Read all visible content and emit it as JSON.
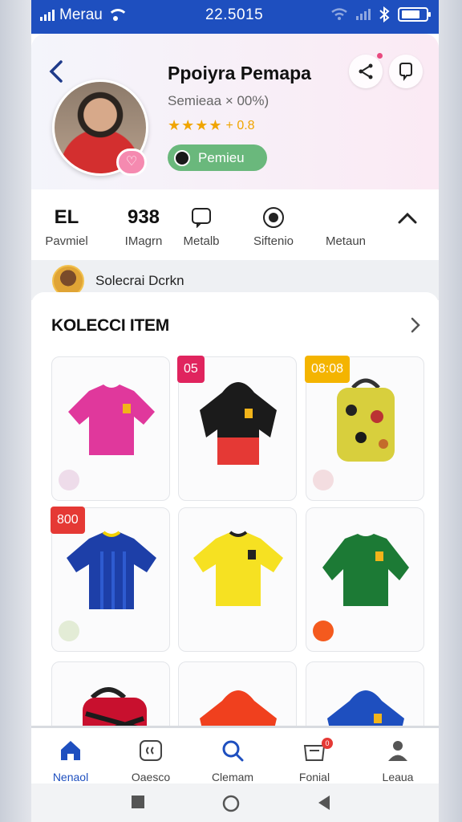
{
  "status_bar": {
    "carrier": "Merau",
    "time": "22.5015"
  },
  "profile": {
    "name": "Ppoiyra Pemapa",
    "subtitle": "Semieaa × 00%)",
    "rating_stars": "★★★★",
    "rating_text": "+ 0.8",
    "premium_label": "Pemieu"
  },
  "stats": [
    {
      "value": "EL",
      "label": "Pavmiel"
    },
    {
      "value": "938",
      "label": "IMagrn"
    },
    {
      "icon": "square-chat-icon",
      "label": "Metalb"
    },
    {
      "icon": "record-icon",
      "label": "Siftenio"
    },
    {
      "icon": "",
      "label": "Metaun"
    }
  ],
  "selection": {
    "text": "Solecrai Dcrkn"
  },
  "collection": {
    "title": "KOLECCI ITEM",
    "items": [
      {
        "name": "magenta-jersey",
        "tag": "",
        "color": "#e0389c",
        "dot": "#eedcea"
      },
      {
        "name": "black-red-hoodie",
        "tag": "05",
        "tag_color": "#e0245e",
        "color": "#1b1b1b",
        "accent": "#e53935"
      },
      {
        "name": "yellow-patch-backpack",
        "tag": "08:08",
        "tag_color": "#f4b400",
        "color": "#d8cf3d",
        "dot": "#f3dde0"
      },
      {
        "name": "blue-striped-jersey",
        "tag": "800",
        "tag_color": "#e53935",
        "color": "#1d3fa8",
        "accent": "#f2d200",
        "dot": "#e3ecd6"
      },
      {
        "name": "yellow-jersey",
        "tag": "",
        "color": "#f6e122"
      },
      {
        "name": "green-sweatshirt",
        "tag": "",
        "color": "#1c7a35",
        "dot": "#f45a1e"
      },
      {
        "name": "red-black-bag",
        "tag": "",
        "color": "#c8102e"
      },
      {
        "name": "orange-red-hoodie",
        "tag": "",
        "color": "#f0401e"
      },
      {
        "name": "blue-hoodie",
        "tag": "",
        "color": "#1e4fbf"
      }
    ]
  },
  "bottom_nav": [
    {
      "label": "Nenaol",
      "icon": "home-icon",
      "active": true
    },
    {
      "label": "Oaesco",
      "icon": "quote-icon",
      "active": false
    },
    {
      "label": "Clemam",
      "icon": "search-icon",
      "active": false
    },
    {
      "label": "Fonial",
      "icon": "shop-icon",
      "active": false,
      "badge": "0"
    },
    {
      "label": "Leaua",
      "icon": "person-icon",
      "active": false
    }
  ],
  "colors": {
    "primary": "#1e4fbf",
    "premium": "#6ab87c",
    "star": "#f0a500"
  }
}
